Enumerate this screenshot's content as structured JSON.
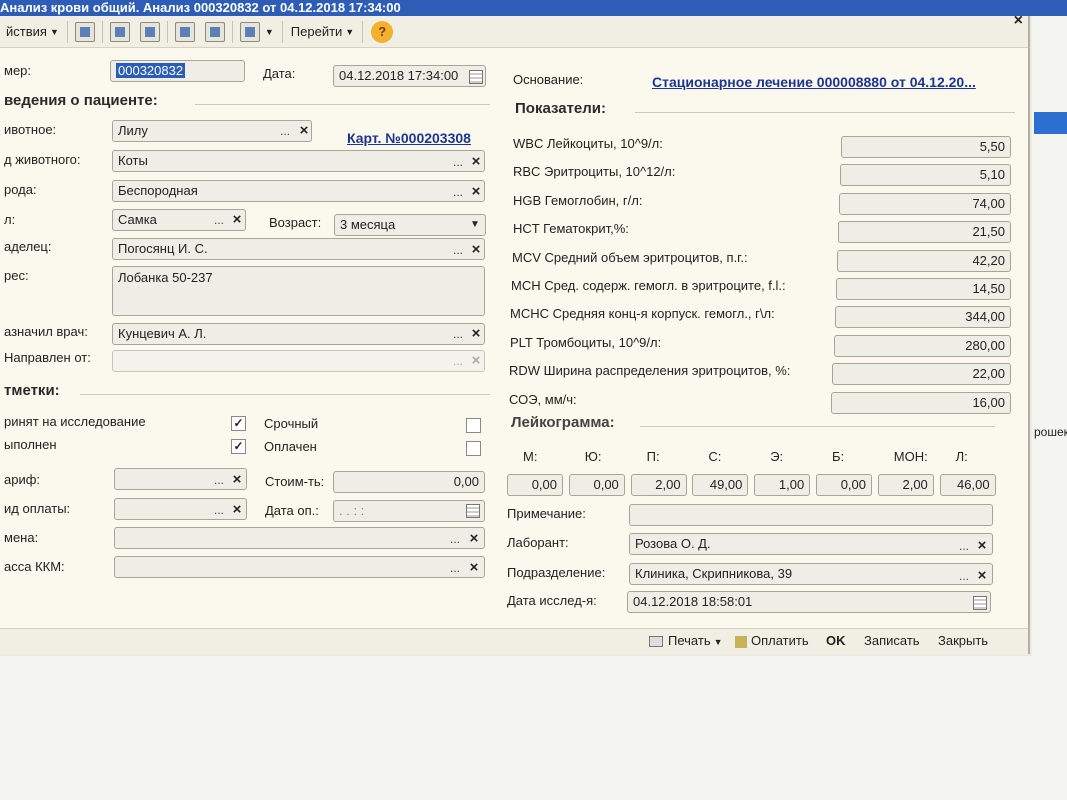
{
  "window": {
    "title": "Анализ крови общий. Анализ 000320832 от 04.12.2018 17:34:00",
    "close_glyph": "×"
  },
  "toolbar": {
    "actions_label": "йствия",
    "goto_label": "Перейти",
    "help_label": "?"
  },
  "header": {
    "number_label": "мер:",
    "number_value": "000320832",
    "date_label": "Дата:",
    "date_value": "04.12.2018 17:34:00",
    "basis_label": "Основание:",
    "basis_value": "Стационарное лечение 000008880 от 04.12.20..."
  },
  "patient": {
    "section_title": "ведения о пациенте:",
    "animal_label": "ивотное:",
    "animal_value": "Лилу",
    "card_link": "Карт. №000203308",
    "species_label": "д животного:",
    "species_value": "Коты",
    "breed_label": "рода:",
    "breed_value": "Беспородная",
    "sex_label": "л:",
    "sex_value": "Самка",
    "age_label": "Возраст:",
    "age_value": "3 месяца",
    "owner_label": "аделец:",
    "owner_value": "Погосянц И. С.",
    "address_label": "рес:",
    "address_value": "Лобанка 50-237",
    "doctor_label": "азначил врач:",
    "doctor_value": "Кунцевич А. Л.",
    "referred_label": "Направлен от:",
    "referred_value": ""
  },
  "marks": {
    "section_title": "тметки:",
    "accepted_label": "ринят на исследование",
    "accepted_checked": "✓",
    "done_label": "ыполнен",
    "done_checked": "✓",
    "urgent_label": "Срочный",
    "paid_label": "Оплачен",
    "tariff_label": "ариф:",
    "cost_label": "Стоим-ть:",
    "cost_value": "0,00",
    "paytype_label": "ид оплаты:",
    "paydate_label": "Дата оп.:",
    "paydate_value": ". .   : :",
    "shift_label": "мена:",
    "kkm_label": "асса ККМ:"
  },
  "indicators": {
    "section_title": "Показатели:",
    "rows": [
      {
        "label": "WBC  Лейкоциты, 10^9/л:",
        "value": "5,50"
      },
      {
        "label": "RBC  Эритроциты, 10^12/л:",
        "value": "5,10"
      },
      {
        "label": "HGB  Гемоглобин, г/л:",
        "value": "74,00"
      },
      {
        "label": "HCT   Гематокрит,%:",
        "value": "21,50"
      },
      {
        "label": "MCV Средний объем эритроцитов, п.г.:",
        "value": "42,20"
      },
      {
        "label": "MCH  Сред. содерж. гемогл. в эритроците, f.l.:",
        "value": "14,50"
      },
      {
        "label": "MCHC Средняя конц-я корпуск. гемогл., г\\л:",
        "value": "344,00"
      },
      {
        "label": "PLT Тромбоциты, 10^9/л:",
        "value": "280,00"
      },
      {
        "label": "RDW Ширина распределения эритроцитов, %:",
        "value": "22,00"
      },
      {
        "label": "СОЭ, мм/ч:",
        "value": "16,00"
      }
    ]
  },
  "leuko": {
    "section_title": "Лейкограмма:",
    "cols": [
      {
        "label": "М:",
        "value": "0,00"
      },
      {
        "label": "Ю:",
        "value": "0,00"
      },
      {
        "label": "П:",
        "value": "2,00"
      },
      {
        "label": "С:",
        "value": "49,00"
      },
      {
        "label": "Э:",
        "value": "1,00"
      },
      {
        "label": "Б:",
        "value": "0,00"
      },
      {
        "label": "МОН:",
        "value": "2,00"
      },
      {
        "label": "Л:",
        "value": "46,00"
      }
    ],
    "note_label": "Примечание:",
    "note_value": "",
    "lab_label": "Лаборант:",
    "lab_value": "Розова О. Д.",
    "dept_label": "Подразделение:",
    "dept_value": "Клиника, Скрипникова, 39",
    "studydate_label": "Дата исслед-я:",
    "studydate_value": "04.12.2018 18:58:01"
  },
  "bottom": {
    "print_label": "Печать",
    "pay_label": "Оплатить",
    "ok_label": "OK",
    "save_label": "Записать",
    "close_label": "Закрыть"
  },
  "side": {
    "fragment": "рошек"
  }
}
